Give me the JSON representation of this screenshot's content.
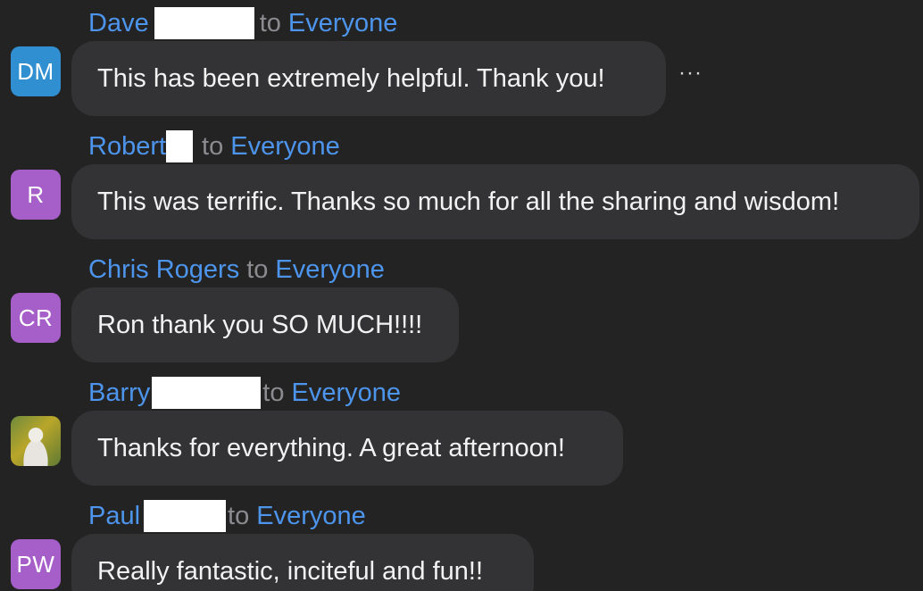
{
  "messages": [
    {
      "sender": "Dave",
      "to_word": "to",
      "recipient": "Everyone",
      "avatar_initials": "DM",
      "avatar_color": "#2f8fd0",
      "text": "This has been extremely helpful.  Thank you!",
      "more_label": "···"
    },
    {
      "sender": "Robert",
      "to_word": "to",
      "recipient": "Everyone",
      "avatar_initials": "R",
      "avatar_color": "#a65fc9",
      "text": "This was terrific.  Thanks so much for all the sharing and wisdom!"
    },
    {
      "sender": "Chris Rogers",
      "to_word": "to",
      "recipient": "Everyone",
      "avatar_initials": "CR",
      "avatar_color": "#a65fc9",
      "text": "Ron thank you SO MUCH!!!!"
    },
    {
      "sender": "Barry",
      "to_word": "to",
      "recipient": "Everyone",
      "avatar_icon": "profile-photo",
      "text": "Thanks for everything. A great afternoon!"
    },
    {
      "sender": "Paul",
      "to_word": "to",
      "recipient": "Everyone",
      "avatar_initials": "PW",
      "avatar_color": "#a65fc9",
      "text": "Really fantastic, inciteful and fun!!"
    }
  ]
}
